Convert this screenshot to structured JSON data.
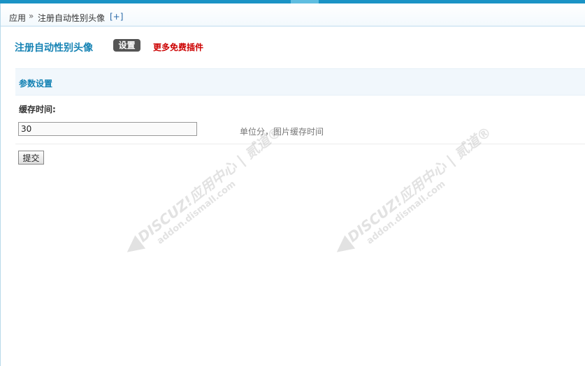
{
  "breadcrumb": {
    "root": "应用",
    "separator": "»",
    "current": "注册自动性别头像",
    "add": "[+]"
  },
  "header": {
    "title": "注册自动性别头像",
    "settings_label": "设置",
    "more_label": "更多免费插件"
  },
  "section": {
    "title": "参数设置"
  },
  "form": {
    "cache_label": "缓存时间:",
    "cache_value": "30",
    "cache_hint": "单位分，图片缓存时间",
    "submit_label": "提交"
  },
  "watermark": {
    "line1": "DISCUZ!应用中心 | 贰道®",
    "line2": "addon.dismall.com"
  }
}
